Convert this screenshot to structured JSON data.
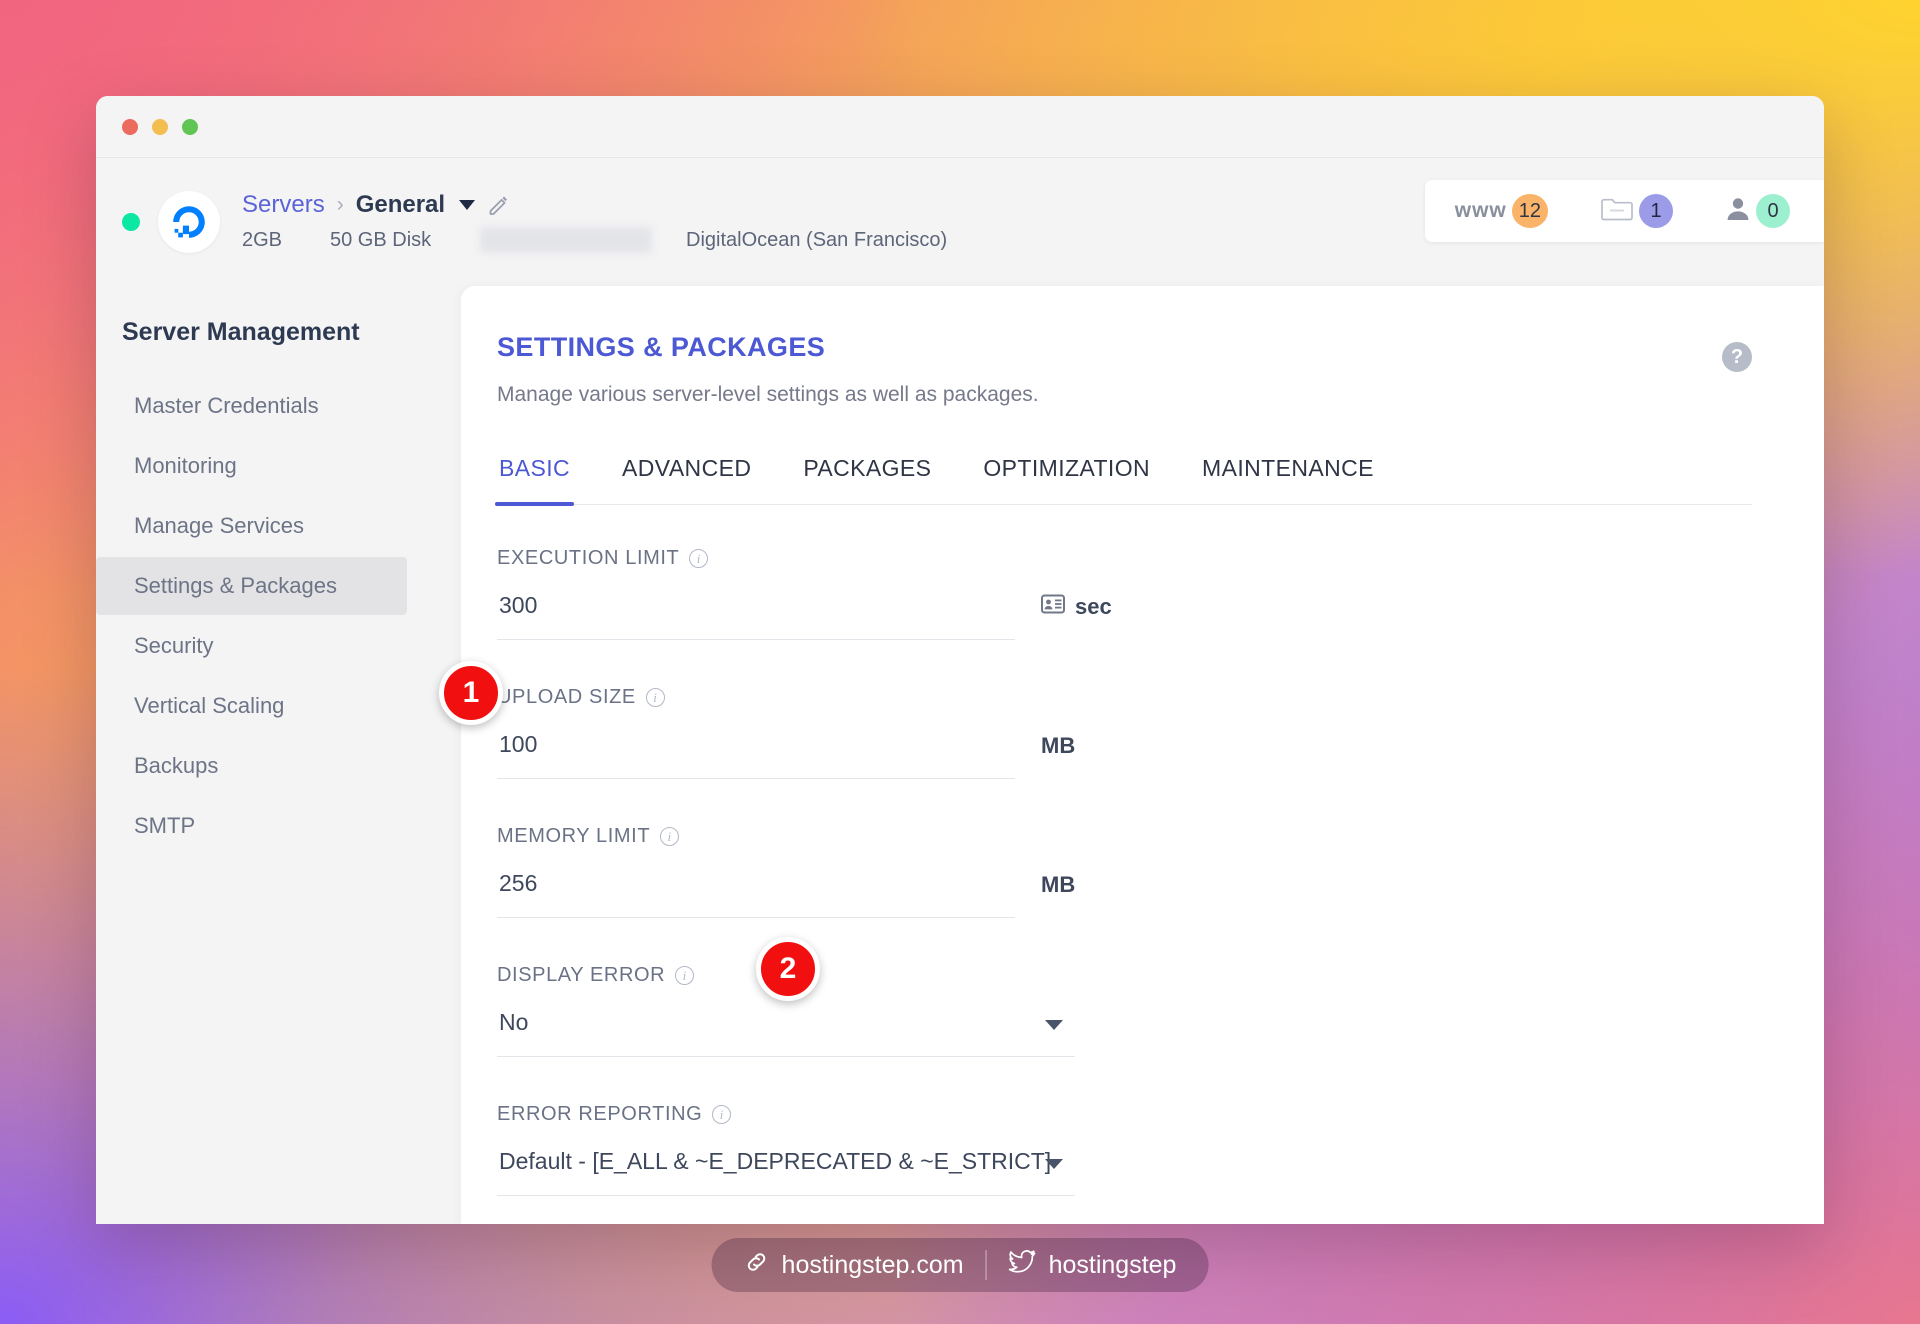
{
  "window": {
    "traffic_lights": [
      "close",
      "minimize",
      "maximize"
    ]
  },
  "server_header": {
    "status": "online",
    "logo": "digitalocean-logo",
    "breadcrumb": {
      "parent": "Servers",
      "separator": "›",
      "current": "General"
    },
    "ram": "2GB",
    "disk": "50 GB Disk",
    "ip_redacted": "",
    "provider": "DigitalOcean (San Francisco)",
    "counters": [
      {
        "icon": "www-icon",
        "label": "www",
        "value": "12",
        "color": "#f9b46a"
      },
      {
        "icon": "folder-icon",
        "label": "",
        "value": "1",
        "color": "#9b9be8"
      },
      {
        "icon": "user-icon",
        "label": "",
        "value": "0",
        "color": "#9df0cf"
      }
    ]
  },
  "sidebar": {
    "title": "Server Management",
    "items": [
      {
        "label": "Master Credentials",
        "active": false
      },
      {
        "label": "Monitoring",
        "active": false
      },
      {
        "label": "Manage Services",
        "active": false
      },
      {
        "label": "Settings & Packages",
        "active": true
      },
      {
        "label": "Security",
        "active": false
      },
      {
        "label": "Vertical Scaling",
        "active": false
      },
      {
        "label": "Backups",
        "active": false
      },
      {
        "label": "SMTP",
        "active": false
      }
    ]
  },
  "main": {
    "title": "SETTINGS & PACKAGES",
    "subtitle": "Manage various server-level settings as well as packages.",
    "help_icon": "help-question-icon",
    "tabs": [
      {
        "label": "BASIC",
        "active": true
      },
      {
        "label": "ADVANCED",
        "active": false
      },
      {
        "label": "PACKAGES",
        "active": false
      },
      {
        "label": "OPTIMIZATION",
        "active": false
      },
      {
        "label": "MAINTENANCE",
        "active": false
      }
    ],
    "fields": [
      {
        "label": "EXECUTION LIMIT",
        "value": "300",
        "unit": "sec",
        "unit_icon": "id-card-icon",
        "type": "number"
      },
      {
        "label": "UPLOAD SIZE",
        "value": "100",
        "unit": "MB",
        "unit_icon": "",
        "type": "number"
      },
      {
        "label": "MEMORY LIMIT",
        "value": "256",
        "unit": "MB",
        "unit_icon": "",
        "type": "number"
      },
      {
        "label": "DISPLAY ERROR",
        "value": "No",
        "unit": "",
        "unit_icon": "",
        "type": "select"
      },
      {
        "label": "ERROR REPORTING",
        "value": "Default - [E_ALL & ~E_DEPRECATED & ~E_STRICT]",
        "unit": "",
        "unit_icon": "",
        "type": "select"
      }
    ]
  },
  "markers": [
    {
      "number": "1",
      "target": "Settings & Packages"
    },
    {
      "number": "2",
      "target": "MEMORY LIMIT"
    }
  ],
  "footer": {
    "site_icon": "link-icon",
    "site": "hostingstep.com",
    "social_icon": "twitter-icon",
    "social": "hostingstep"
  },
  "colors": {
    "accent": "#4c58d4",
    "marker": "#f20f0f",
    "status_online": "#0ce8a4"
  }
}
